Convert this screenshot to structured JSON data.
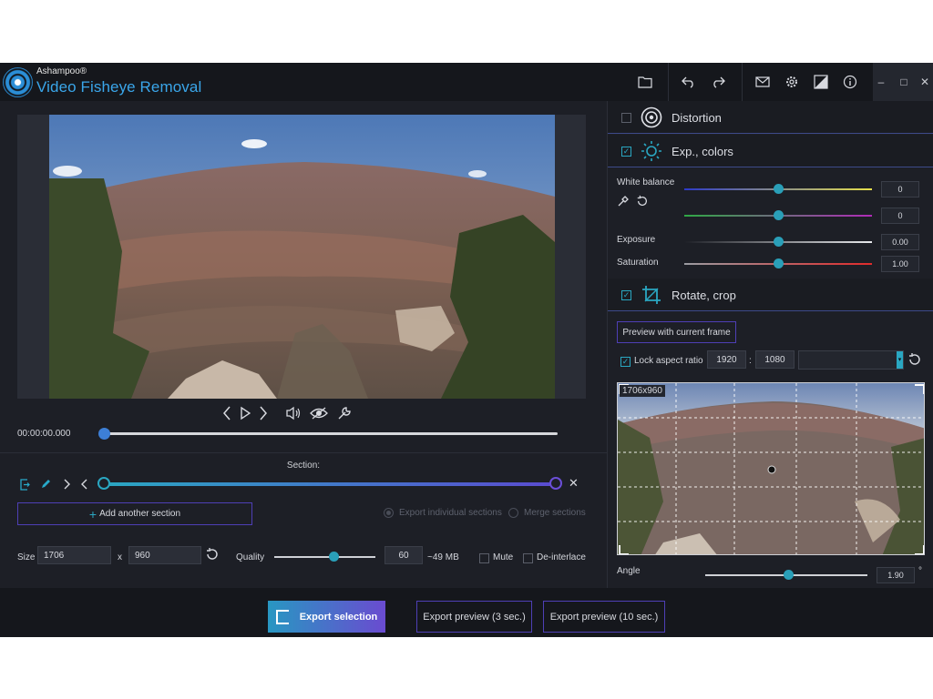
{
  "app": {
    "brand_small": "Ashampoo®",
    "brand_title": "Video Fisheye Removal",
    "accent": "#2aa7c2",
    "accent2": "#5a4bd0"
  },
  "toolbar": {
    "icons": [
      "folder-icon",
      "undo-icon",
      "redo-icon",
      "mail-icon",
      "settings-icon",
      "compare-icon",
      "info-icon"
    ],
    "window_controls": [
      "minimize",
      "maximize",
      "close"
    ]
  },
  "player": {
    "time": "00:00:00.000",
    "position": 0
  },
  "section": {
    "label": "Section:",
    "add_label": "Add another section",
    "radio_individual": "Export individual sections",
    "radio_merge": "Merge sections"
  },
  "output": {
    "size_label": "Size",
    "width": "1706",
    "times": "x",
    "height": "960",
    "quality_label": "Quality",
    "quality_value": "60",
    "quality_fraction": 0.59,
    "estimate": "~49 MB",
    "mute_label": "Mute",
    "deinterlace_label": "De-interlace"
  },
  "export": {
    "main_label": "Export selection",
    "preview3_label": "Export preview (3 sec.)",
    "preview10_label": "Export preview (10 sec.)"
  },
  "panels": {
    "distortion": {
      "label": "Distortion",
      "enabled": false
    },
    "colors": {
      "label": "Exp., colors",
      "enabled": true,
      "white_balance_label": "White balance",
      "wb1_value": "0",
      "wb2_value": "0",
      "exposure_label": "Exposure",
      "exposure_value": "0.00",
      "saturation_label": "Saturation",
      "saturation_value": "1.00",
      "slider_fraction": 0.5
    },
    "crop": {
      "label": "Rotate, crop",
      "enabled": true,
      "preview_btn": "Preview with current frame",
      "lock_label": "Lock aspect ratio",
      "ratio_w": "1920",
      "ratio_sep": ":",
      "ratio_h": "1080",
      "crop_size": "1706x960",
      "angle_label": "Angle",
      "angle_value": "1.90",
      "angle_unit": "°",
      "angle_fraction": 0.51
    }
  }
}
